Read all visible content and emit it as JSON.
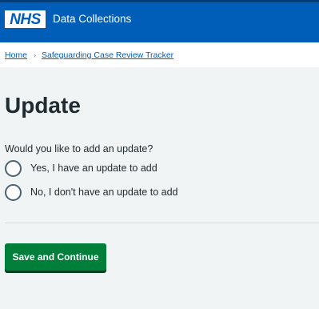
{
  "header": {
    "logo_text": "NHS",
    "service_name": "Data Collections",
    "brand_color": "#005eb8"
  },
  "breadcrumb": {
    "items": [
      {
        "label": "Home"
      },
      {
        "label": "Safeguarding Case Review Tracker"
      }
    ],
    "separator": "›"
  },
  "main": {
    "title": "Update",
    "question": "Would you like to add an update?",
    "options": [
      {
        "label": "Yes, I have an update to add",
        "selected": false
      },
      {
        "label": "No, I don't have an update to add",
        "selected": false
      }
    ],
    "submit_label": "Save and Continue",
    "submit_color": "#007f3b"
  }
}
